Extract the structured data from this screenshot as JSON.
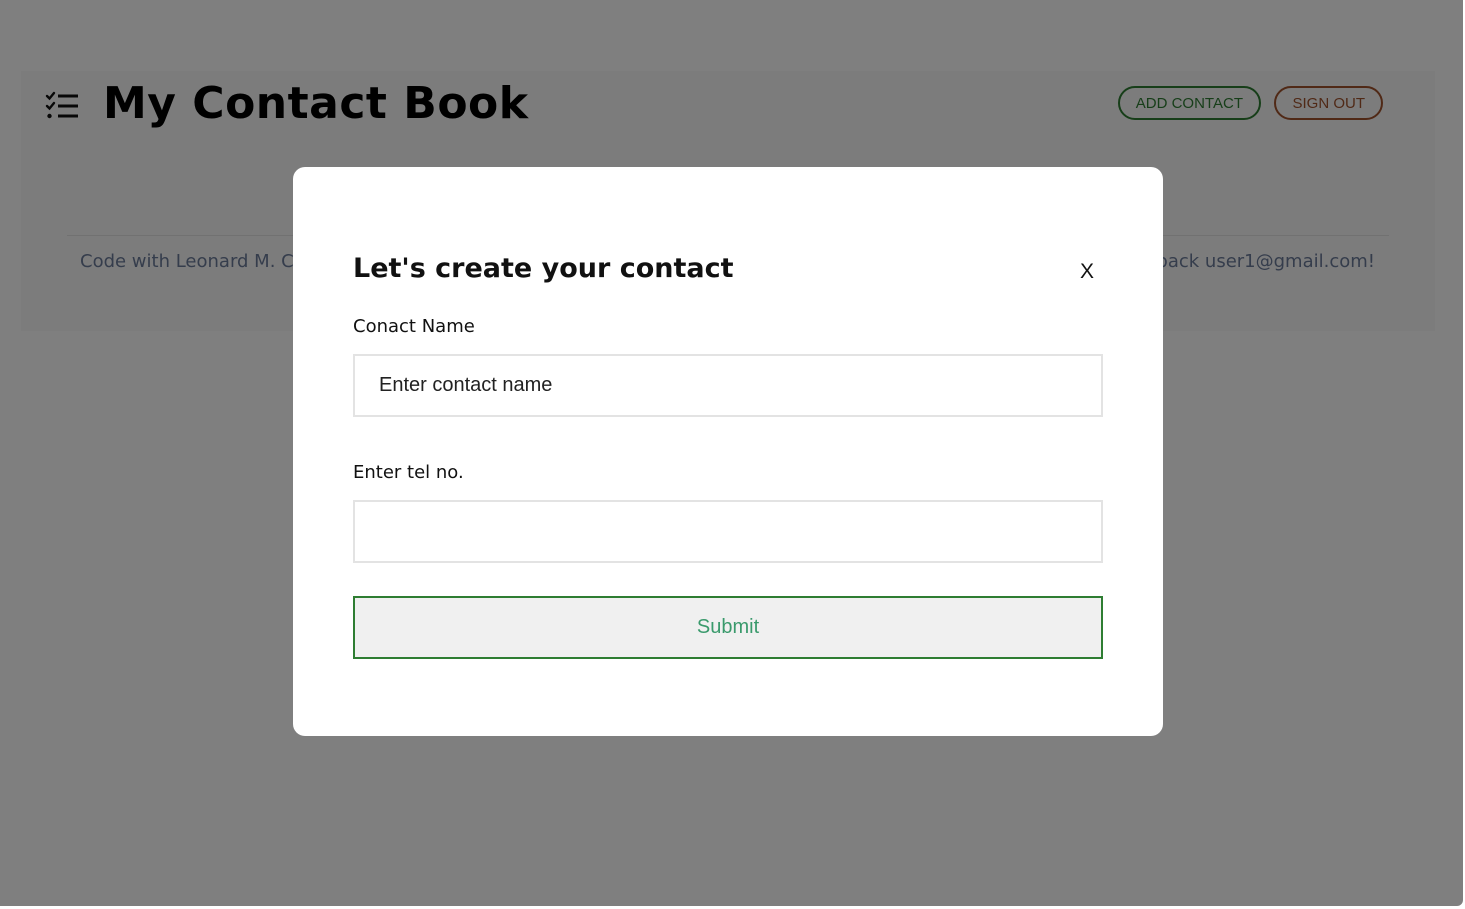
{
  "app": {
    "title": "My Contact Book",
    "buttons": {
      "add_contact": "ADD CONTACT",
      "sign_out": "SIGN OUT"
    },
    "footer": {
      "credit": "Code with Leonard M. Cr",
      "welcome": "back user1@gmail.com!"
    }
  },
  "modal": {
    "title": "Let's create your contact",
    "close_label": "X",
    "name_label": "Conact Name",
    "name_placeholder": "Enter contact name",
    "tel_label": "Enter tel no.",
    "tel_placeholder": "",
    "submit_label": "Submit"
  },
  "colors": {
    "overlay": "rgba(0,0,0,0.5)",
    "add_contact_accent": "#2e7d32",
    "sign_out_accent": "#a0522d",
    "submit_text": "#3a9a6c",
    "footer_text": "#6b7a99"
  },
  "icons": {
    "menu": "checklist-icon"
  }
}
